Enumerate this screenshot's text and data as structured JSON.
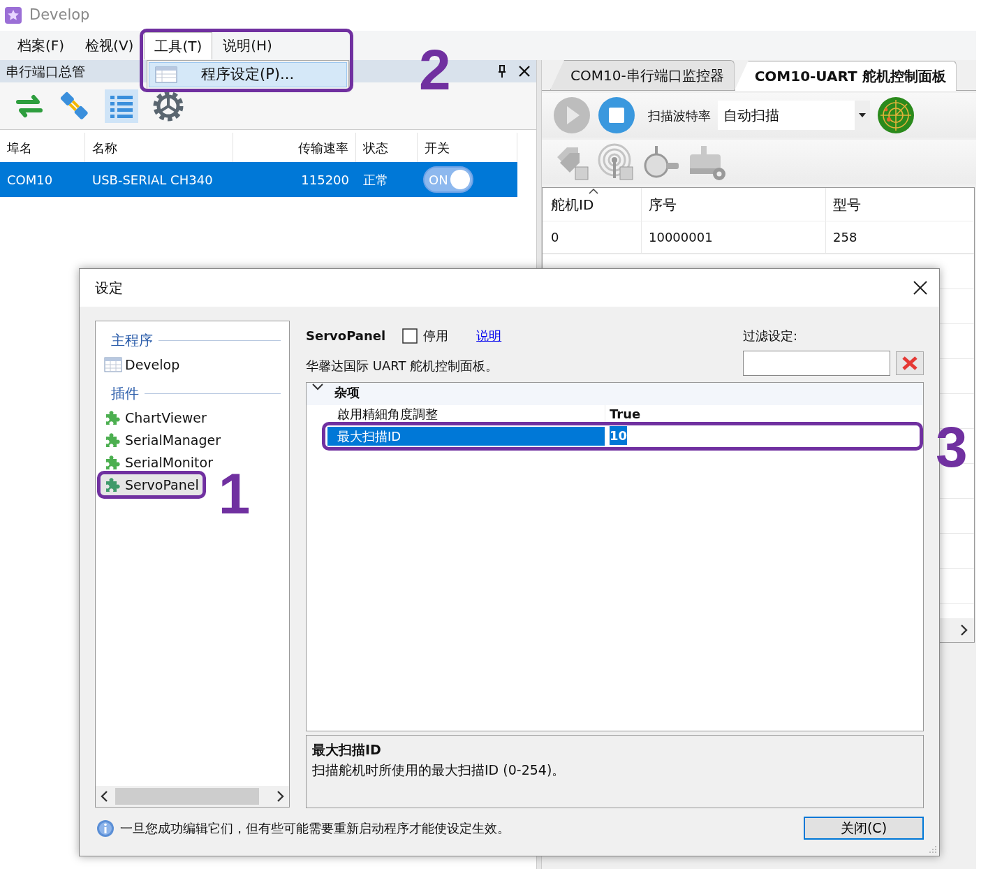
{
  "window": {
    "title": "Develop"
  },
  "menu": [
    {
      "label": "档案(F)",
      "selected": false
    },
    {
      "label": "检视(V)",
      "selected": false
    },
    {
      "label": "工具(T)",
      "selected": true
    },
    {
      "label": "说明(H)",
      "selected": false
    }
  ],
  "open_menu": {
    "items": [
      {
        "label": "程序设定(P)..."
      }
    ]
  },
  "left_panel": {
    "title": "串行端口总管",
    "table": {
      "columns": [
        "埠名",
        "名称",
        "传输速率",
        "状态",
        "开关"
      ],
      "rows": [
        {
          "cells": [
            "COM10",
            "USB-SERIAL CH340",
            "115200",
            "正常"
          ],
          "switch": {
            "label": "ON",
            "on": true
          },
          "selected": true
        }
      ]
    }
  },
  "right_panel": {
    "tabs": [
      {
        "label": "COM10-串行端口监控器",
        "selected": false
      },
      {
        "label": "COM10-UART 舵机控制面板",
        "selected": true
      }
    ],
    "baud_label": "扫描波特率",
    "baud_value": "自动扫描",
    "table": {
      "columns": [
        "舵机ID",
        "序号",
        "型号"
      ],
      "rows": [
        [
          "0",
          "10000001",
          "258"
        ]
      ]
    }
  },
  "dialog": {
    "title": "设定",
    "sidebar": [
      {
        "label": "主程序",
        "items": [
          {
            "label": "Develop",
            "kind": "app",
            "selected": false
          }
        ]
      },
      {
        "label": "插件",
        "items": [
          {
            "label": "ChartViewer",
            "kind": "plugin",
            "selected": false
          },
          {
            "label": "SerialManager",
            "kind": "plugin",
            "selected": false
          },
          {
            "label": "SerialMonitor",
            "kind": "plugin",
            "selected": false
          },
          {
            "label": "ServoPanel",
            "kind": "plugin",
            "selected": true
          }
        ]
      }
    ],
    "plugin": {
      "name": "ServoPanel",
      "disable": {
        "label": "停用",
        "checked": false
      },
      "help_link": "说明",
      "description": "华馨达国际 UART 舵机控制面板。"
    },
    "filter_label": "过滤设定:",
    "category": {
      "label": "杂项",
      "expanded": true
    },
    "properties": [
      {
        "name": "啟用精細角度調整",
        "value": "True",
        "selected": false
      },
      {
        "name": "最大扫描ID",
        "value": "10",
        "selected": true
      }
    ],
    "help": {
      "title": "最大扫描ID",
      "text": "扫描舵机时所使用的最大扫描ID (0-254)。"
    },
    "note": "一旦您成功编辑它们，但有些可能需要重新启动程序才能使设定生效。",
    "close_button": "关闭(C)"
  },
  "annotations": [
    {
      "label": "1"
    },
    {
      "label": "2"
    },
    {
      "label": "3"
    }
  ]
}
